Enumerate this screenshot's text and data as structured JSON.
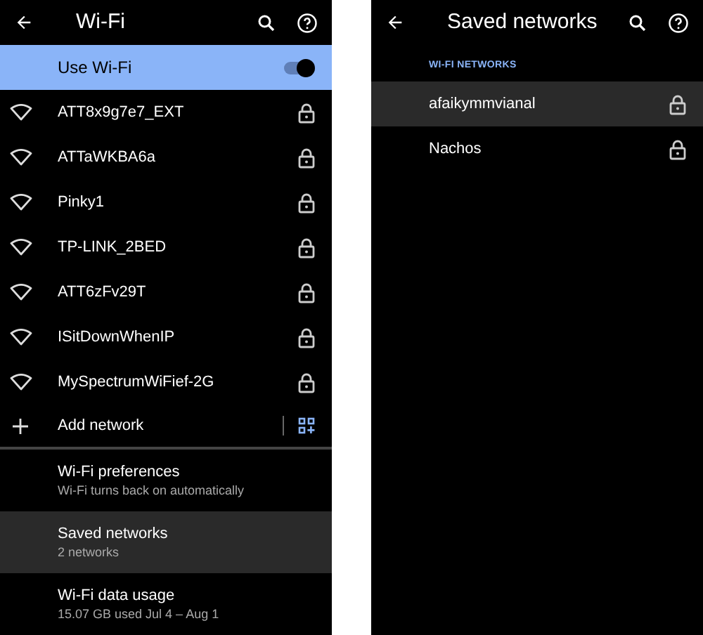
{
  "wifi_screen": {
    "title": "Wi-Fi",
    "use_wifi": {
      "label": "Use Wi-Fi",
      "on": true
    },
    "networks": [
      {
        "name": "ATT8x9g7e7_EXT",
        "locked": true
      },
      {
        "name": "ATTaWKBA6a",
        "locked": true
      },
      {
        "name": "Pinky1",
        "locked": true
      },
      {
        "name": "TP-LINK_2BED",
        "locked": true
      },
      {
        "name": "ATT6zFv29T",
        "locked": true
      },
      {
        "name": "ISitDownWhenIP",
        "locked": true
      },
      {
        "name": "MySpectrumWiFief-2G",
        "locked": true
      }
    ],
    "add_network": "Add network",
    "settings": [
      {
        "title": "Wi-Fi preferences",
        "subtitle": "Wi-Fi turns back on automatically",
        "selected": false
      },
      {
        "title": "Saved networks",
        "subtitle": "2 networks",
        "selected": true
      },
      {
        "title": "Wi-Fi data usage",
        "subtitle": "15.07 GB used Jul 4 – Aug 1",
        "selected": false
      }
    ]
  },
  "saved_screen": {
    "title": "Saved networks",
    "section": "WI-FI NETWORKS",
    "networks": [
      {
        "name": "afaikymmvianal",
        "selected": true
      },
      {
        "name": "Nachos",
        "selected": false
      }
    ]
  }
}
